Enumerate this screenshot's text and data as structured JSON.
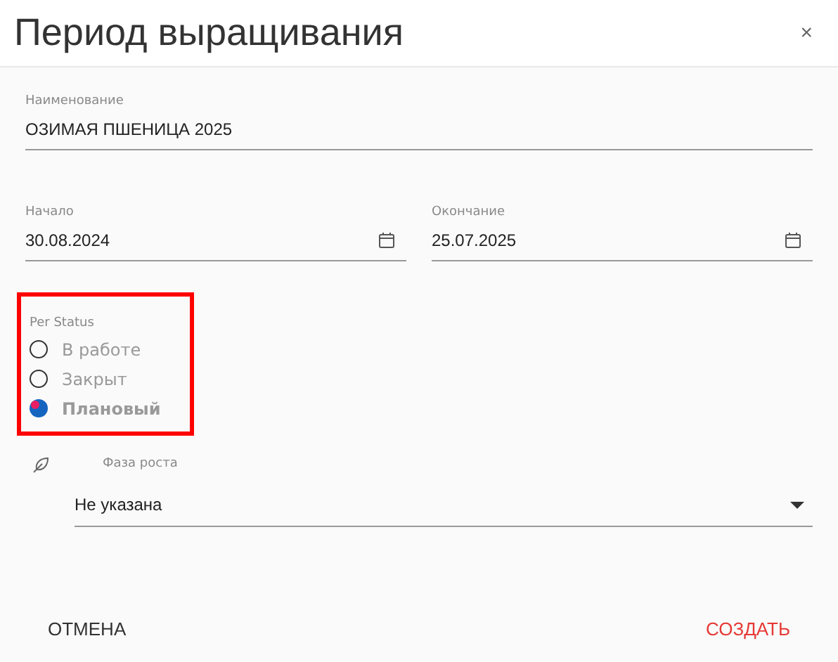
{
  "window": {
    "title": "Период выращивания",
    "close": "×"
  },
  "name_field": {
    "label": "Наименование",
    "value": "ОЗИМАЯ ПШЕНИЦА 2025"
  },
  "start_field": {
    "label": "Начало",
    "value": "30.08.2024"
  },
  "end_field": {
    "label": "Окончание",
    "value": "25.07.2025"
  },
  "status": {
    "label": "Per Status",
    "highlighted": true,
    "options": [
      {
        "label": "В работе",
        "selected": false
      },
      {
        "label": "Закрыт",
        "selected": false
      },
      {
        "label": "Плановый",
        "selected": true
      }
    ]
  },
  "growth_phase": {
    "label": "Фаза роста",
    "value": "Не указана"
  },
  "buttons": [
    {
      "label": "ОТМЕНА",
      "kind": "secondary"
    },
    {
      "label": "СОЗДАТЬ",
      "kind": "primary"
    }
  ]
}
